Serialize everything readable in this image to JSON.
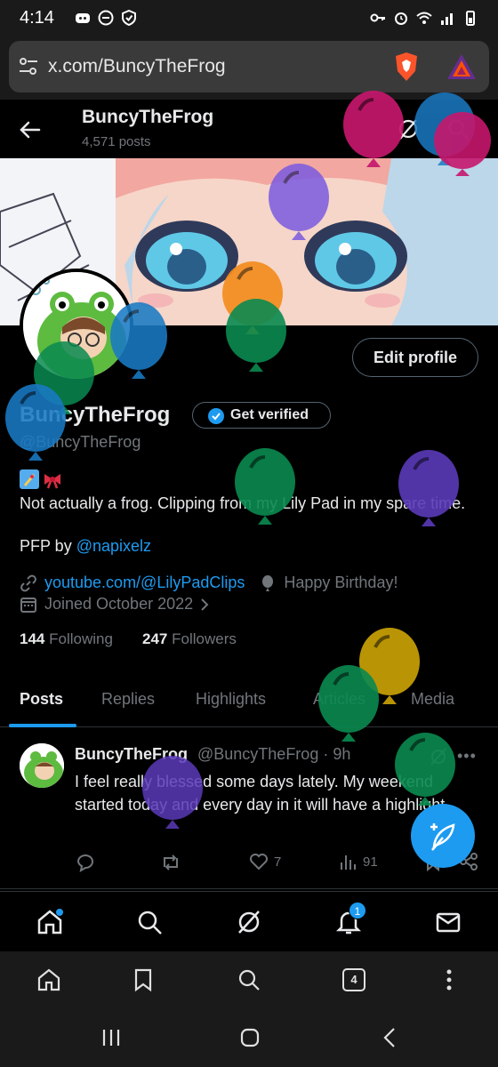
{
  "status_bar": {
    "time": "4:14"
  },
  "browser": {
    "url": "x.com/BuncyTheFrog",
    "tab_count": "4"
  },
  "profile_header": {
    "name": "BuncyTheFrog",
    "posts_count": "4,571 posts"
  },
  "profile": {
    "display_name": "BuncyTheFrog",
    "get_verified_label": "Get verified",
    "handle": "@BuncyTheFrog",
    "edit_profile_label": "Edit profile",
    "bio": "Not actually a frog.  Clipping from my Lily Pad in my spare time.",
    "pfp_prefix": "PFP by ",
    "pfp_link": "@napixelz",
    "website": "youtube.com/@LilyPadClips",
    "birthday": "Happy Birthday!",
    "joined": "Joined October 2022",
    "following_count": "144",
    "following_label": "Following",
    "followers_count": "247",
    "followers_label": "Followers"
  },
  "tabs": [
    "Posts",
    "Replies",
    "Highlights",
    "Articles",
    "Media"
  ],
  "post": {
    "author": "BuncyTheFrog",
    "handle_time": "@BuncyTheFrog · 9h",
    "text": "I feel really blessed some days lately. My weekend started today and every day in it will have a highlight.",
    "likes": "7",
    "views": "91"
  },
  "bottom_nav": {
    "notification_count": "1"
  },
  "colors": {
    "accent": "#1d9bf0",
    "background": "#000000",
    "muted": "#71767b"
  }
}
